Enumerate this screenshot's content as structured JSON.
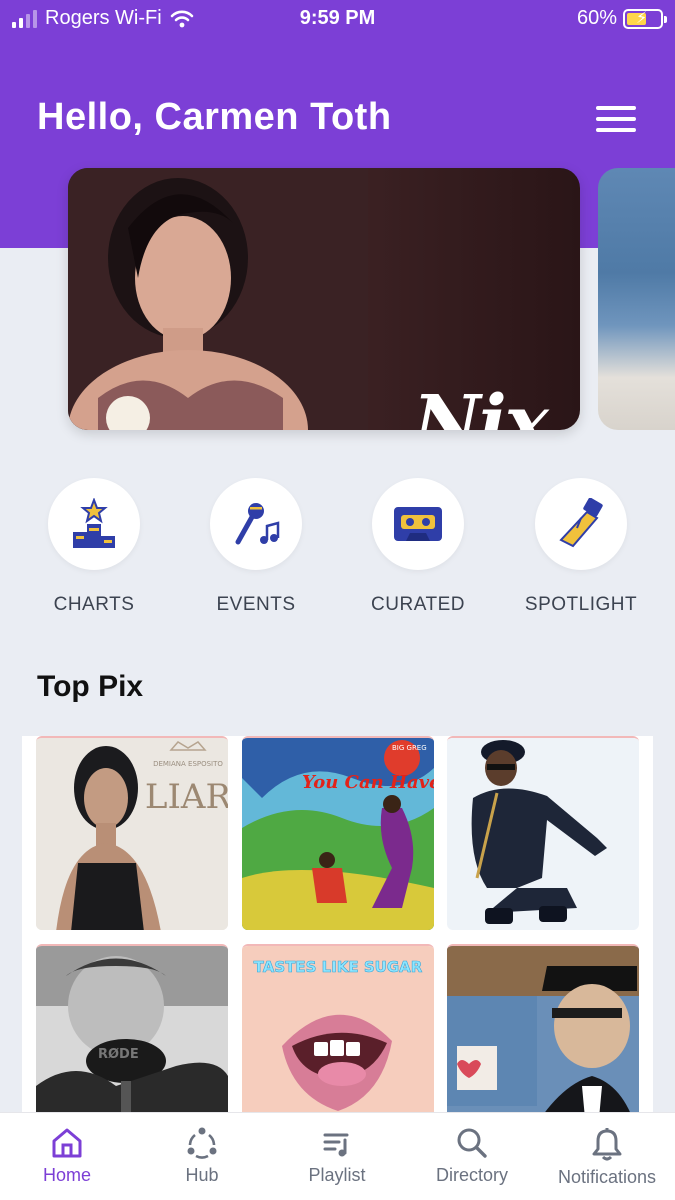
{
  "status_bar": {
    "carrier": "Rogers Wi-Fi",
    "time": "9:59 PM",
    "battery": "60%",
    "battery_level": 0.6
  },
  "header": {
    "greeting": "Hello, Carmen Toth"
  },
  "banner": {
    "title": "Nix"
  },
  "categories": [
    {
      "label": "CHARTS",
      "icon": "podium-star-icon"
    },
    {
      "label": "EVENTS",
      "icon": "microphone-music-icon"
    },
    {
      "label": "CURATED",
      "icon": "cassette-icon"
    },
    {
      "label": "SPOTLIGHT",
      "icon": "spotlight-icon"
    }
  ],
  "top_pix": {
    "title": "Top Pix",
    "tiles": [
      {
        "art_text": "LIAR",
        "art_subtext": "DEMIANA ESPOSITO"
      },
      {
        "art_text": "You Can Have it All",
        "art_subtext": "BIG GREG"
      },
      {
        "art_text": ""
      },
      {
        "art_text": "RØDE"
      },
      {
        "art_text": "TASTES LIKE SUGAR"
      },
      {
        "art_text": ""
      }
    ]
  },
  "tab_bar": {
    "items": [
      {
        "label": "Home",
        "icon": "home-icon",
        "active": true
      },
      {
        "label": "Hub",
        "icon": "hub-icon",
        "active": false
      },
      {
        "label": "Playlist",
        "icon": "playlist-icon",
        "active": false
      },
      {
        "label": "Directory",
        "icon": "search-icon",
        "active": false
      },
      {
        "label": "Notifications",
        "icon": "bell-icon",
        "active": false
      }
    ]
  },
  "colors": {
    "brand": "#7c3fd6",
    "icon_blue": "#2f3ea8",
    "icon_gold": "#f0c13c"
  }
}
